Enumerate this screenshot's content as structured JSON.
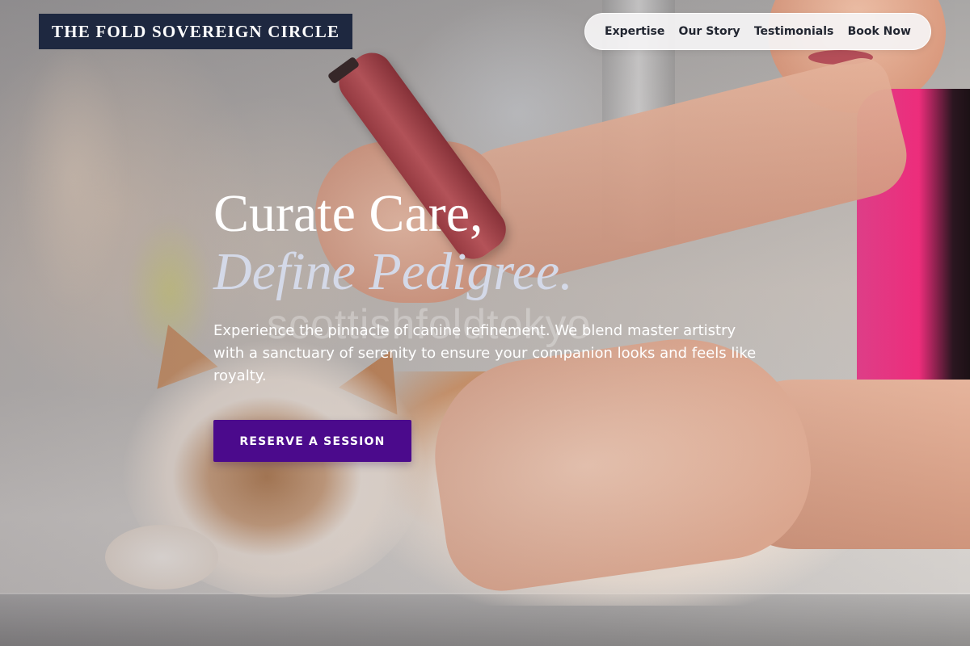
{
  "brand": {
    "name": "THE FOLD SOVEREIGN CIRCLE"
  },
  "nav": {
    "items": [
      {
        "label": "Expertise"
      },
      {
        "label": "Our Story"
      },
      {
        "label": "Testimonials"
      },
      {
        "label": "Book Now"
      }
    ]
  },
  "hero": {
    "headline_line1": "Curate Care,",
    "headline_line2": "Define Pedigree.",
    "subtext": "Experience the pinnacle of canine refinement. We blend master artistry with a sanctuary of serenity to ensure your companion looks and feels like royalty.",
    "cta_label": "RESERVE A SESSION",
    "watermark": "scottishfoldtokyo"
  },
  "colors": {
    "brand_bg": "#1e2840",
    "cta_bg": "#4b0a8c",
    "headline_accent": "#d4d9e8"
  }
}
